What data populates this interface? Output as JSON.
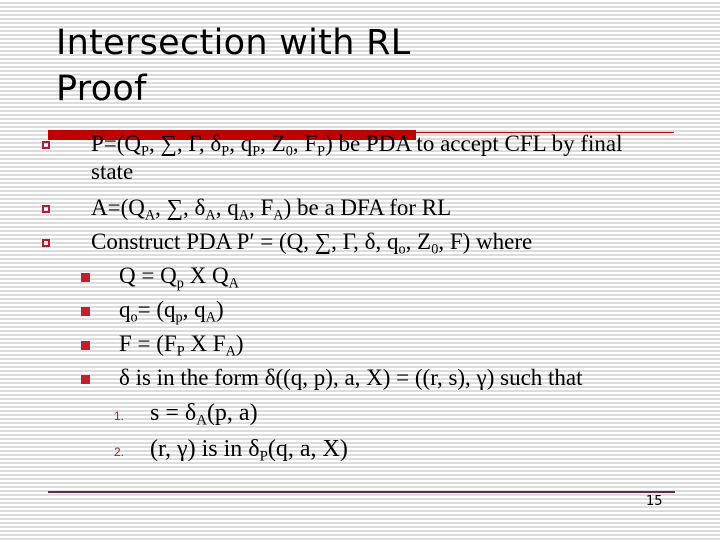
{
  "slide": {
    "title_line1": "Intersection with RL",
    "title_line2": "Proof",
    "page_number": "15"
  },
  "bullets": [
    {
      "level": 1,
      "segments": [
        {
          "t": "P=(Q"
        },
        {
          "sub": "P"
        },
        {
          "t": ", ∑, Γ, δ"
        },
        {
          "sub": "P"
        },
        {
          "t": ", q"
        },
        {
          "sub": "P"
        },
        {
          "t": ", Z"
        },
        {
          "sub": "0"
        },
        {
          "t": ", F"
        },
        {
          "sub": "P"
        },
        {
          "t": ") be PDA to accept CFL by final"
        }
      ],
      "continuation": "state"
    },
    {
      "level": 1,
      "segments": [
        {
          "t": "A=(Q"
        },
        {
          "sub": "A"
        },
        {
          "t": ", ∑, δ"
        },
        {
          "sub": "A"
        },
        {
          "t": ", q"
        },
        {
          "sub": "A"
        },
        {
          "t": ", F"
        },
        {
          "sub": "A"
        },
        {
          "t": ") be a DFA for RL"
        }
      ]
    },
    {
      "level": 1,
      "segments": [
        {
          "t": "Construct PDA P′  = (Q, ∑, Γ, δ, q"
        },
        {
          "sub": "o"
        },
        {
          "t": ", Z"
        },
        {
          "sub": "0"
        },
        {
          "t": ", F) where"
        }
      ]
    },
    {
      "level": 2,
      "segments": [
        {
          "t": "Q = Q"
        },
        {
          "sub": "p"
        },
        {
          "t": " X Q"
        },
        {
          "sub": "A"
        }
      ]
    },
    {
      "level": 2,
      "segments": [
        {
          "t": "q"
        },
        {
          "sub": "o"
        },
        {
          "t": "= (q"
        },
        {
          "sub": "p"
        },
        {
          "t": ", q"
        },
        {
          "sub": "A"
        },
        {
          "t": ")"
        }
      ]
    },
    {
      "level": 2,
      "segments": [
        {
          "t": "F = (F"
        },
        {
          "sub": "P"
        },
        {
          "t": " X F"
        },
        {
          "sub": "A"
        },
        {
          "t": ")"
        }
      ]
    },
    {
      "level": 2,
      "segments": [
        {
          "t": "δ is in the form δ((q, p), a, X) = ((r, s), γ) such that"
        }
      ]
    },
    {
      "level": 3,
      "number": "1.",
      "segments": [
        {
          "t": "s = δ"
        },
        {
          "sub": "A"
        },
        {
          "t": "(p, a)"
        }
      ]
    },
    {
      "level": 3,
      "number": "2.",
      "segments": [
        {
          "t": "(r, γ) is in δ"
        },
        {
          "sub": "P"
        },
        {
          "t": "(q, a, X)"
        }
      ]
    }
  ],
  "colors": {
    "accent_red": "#c00000",
    "bullet_red": "#c0202c",
    "footer_line": "#6b2b3a"
  }
}
